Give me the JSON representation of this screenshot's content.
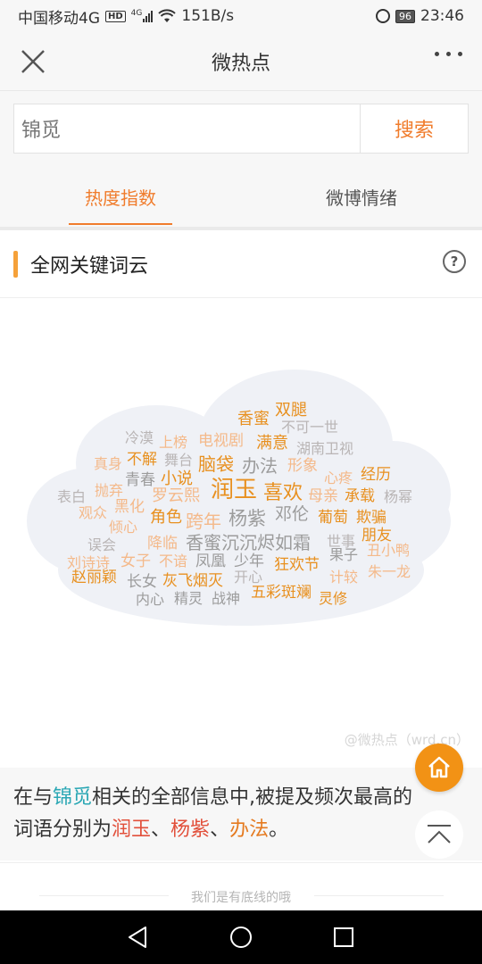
{
  "status_bar": {
    "carrier": "中国移动4G",
    "hd": "HD",
    "net_small": "4G",
    "speed": "151B/s",
    "battery": "96",
    "time": "23:46"
  },
  "nav": {
    "title": "微热点"
  },
  "search": {
    "query": "锦觅",
    "button": "搜索"
  },
  "tabs": [
    {
      "label": "热度指数",
      "active": true
    },
    {
      "label": "微博情绪",
      "active": false
    }
  ],
  "section": {
    "title": "全网关键词云",
    "help": "?"
  },
  "word_cloud": [
    {
      "text": "双腿",
      "color": "#e8901f"
    },
    {
      "text": "香蜜",
      "color": "#e8901f"
    },
    {
      "text": "不可一世",
      "color": "#b9b5b5"
    },
    {
      "text": "冷漠",
      "color": "#b9b5b5"
    },
    {
      "text": "上榜",
      "color": "#f4b98a"
    },
    {
      "text": "电视剧",
      "color": "#f4b98a"
    },
    {
      "text": "满意",
      "color": "#e8901f"
    },
    {
      "text": "湖南卫视",
      "color": "#b9b5b5"
    },
    {
      "text": "真身",
      "color": "#f4b98a"
    },
    {
      "text": "不解",
      "color": "#e8901f"
    },
    {
      "text": "舞台",
      "color": "#b9b5b5"
    },
    {
      "text": "脑袋",
      "color": "#e8901f"
    },
    {
      "text": "办法",
      "color": "#9c9c9c"
    },
    {
      "text": "形象",
      "color": "#f4b98a"
    },
    {
      "text": "心疼",
      "color": "#f4b98a"
    },
    {
      "text": "经历",
      "color": "#e8901f"
    },
    {
      "text": "青春",
      "color": "#9c9c9c"
    },
    {
      "text": "小说",
      "color": "#e8901f"
    },
    {
      "text": "表白",
      "color": "#b9b5b5"
    },
    {
      "text": "抛弃",
      "color": "#f4b98a"
    },
    {
      "text": "罗云熙",
      "color": "#f4b98a"
    },
    {
      "text": "润玉",
      "color": "#e8901f"
    },
    {
      "text": "喜欢",
      "color": "#e8901f"
    },
    {
      "text": "母亲",
      "color": "#f4b98a"
    },
    {
      "text": "承载",
      "color": "#e8901f"
    },
    {
      "text": "杨幂",
      "color": "#b9b5b5"
    },
    {
      "text": "观众",
      "color": "#f4b98a"
    },
    {
      "text": "黑化",
      "color": "#f4b98a"
    },
    {
      "text": "角色",
      "color": "#e8901f"
    },
    {
      "text": "跨年",
      "color": "#f4b98a"
    },
    {
      "text": "杨紫",
      "color": "#9c9c9c"
    },
    {
      "text": "邓伦",
      "color": "#9c9c9c"
    },
    {
      "text": "葡萄",
      "color": "#e8901f"
    },
    {
      "text": "欺骗",
      "color": "#e8901f"
    },
    {
      "text": "倾心",
      "color": "#f4b98a"
    },
    {
      "text": "误会",
      "color": "#b9b5b5"
    },
    {
      "text": "降临",
      "color": "#f4b98a"
    },
    {
      "text": "香蜜沉沉烬如霜",
      "color": "#9c9c9c"
    },
    {
      "text": "世事",
      "color": "#b9b5b5"
    },
    {
      "text": "朋友",
      "color": "#e8901f"
    },
    {
      "text": "刘诗诗",
      "color": "#f4b98a"
    },
    {
      "text": "女子",
      "color": "#f4b98a"
    },
    {
      "text": "不谙",
      "color": "#f4b98a"
    },
    {
      "text": "凤凰",
      "color": "#9c9c9c"
    },
    {
      "text": "少年",
      "color": "#9c9c9c"
    },
    {
      "text": "狂欢节",
      "color": "#e8901f"
    },
    {
      "text": "果子",
      "color": "#9c9c9c"
    },
    {
      "text": "丑小鸭",
      "color": "#f4b98a"
    },
    {
      "text": "赵丽颖",
      "color": "#e8901f"
    },
    {
      "text": "长女",
      "color": "#9c9c9c"
    },
    {
      "text": "灰飞烟灭",
      "color": "#e8901f"
    },
    {
      "text": "开心",
      "color": "#b9b5b5"
    },
    {
      "text": "计较",
      "color": "#f4b98a"
    },
    {
      "text": "朱一龙",
      "color": "#f4b98a"
    },
    {
      "text": "内心",
      "color": "#9c9c9c"
    },
    {
      "text": "精灵",
      "color": "#9c9c9c"
    },
    {
      "text": "战神",
      "color": "#9c9c9c"
    },
    {
      "text": "五彩斑斓",
      "color": "#e8901f"
    },
    {
      "text": "灵修",
      "color": "#e8901f"
    }
  ],
  "watermark": "@微热点（wrd.cn）",
  "summary": {
    "prefix": "在与",
    "keyword": "锦觅",
    "middle": "相关的全部信息中,被提及频次最高的词语分别为",
    "word1": "润玉",
    "sep1": "、",
    "word2": "杨紫",
    "sep2": "、",
    "word3": "办法",
    "end": "。"
  },
  "footer": {
    "text": "我们是有底线的哦"
  },
  "colors": {
    "accent": "#f07c2c",
    "fab": "#f29215",
    "cloud": "#eff1f6"
  }
}
